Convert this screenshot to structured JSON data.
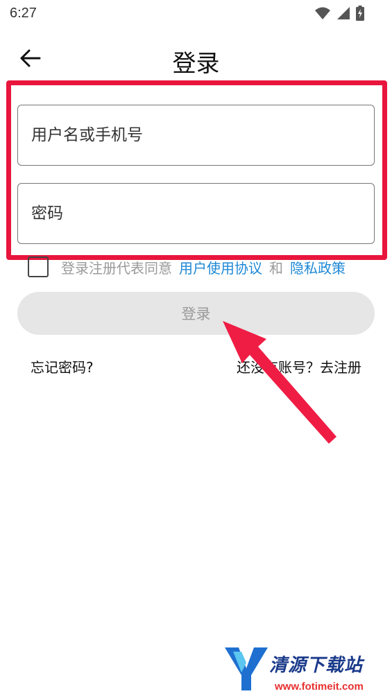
{
  "status_bar": {
    "time": "6:27",
    "icons": [
      "wifi-icon",
      "signal-icon",
      "battery-charging-icon"
    ]
  },
  "header": {
    "back_icon": "arrow-left-icon",
    "title": "登录"
  },
  "form": {
    "username_placeholder": "用户名或手机号",
    "password_placeholder": "密码"
  },
  "agreement": {
    "text": "登录注册代表同意",
    "link_terms": "用户使用协议",
    "and": "和",
    "link_privacy": "隐私政策"
  },
  "login_button": "登录",
  "links": {
    "forgot_password": "忘记密码?",
    "register": "还没有账号？去注册"
  },
  "watermark": {
    "title": "清源下载站",
    "url": "www.fotimeit.com"
  },
  "colors": {
    "highlight": "#e8163c",
    "link": "#1e88d6",
    "button_bg": "#e6e6e6"
  }
}
